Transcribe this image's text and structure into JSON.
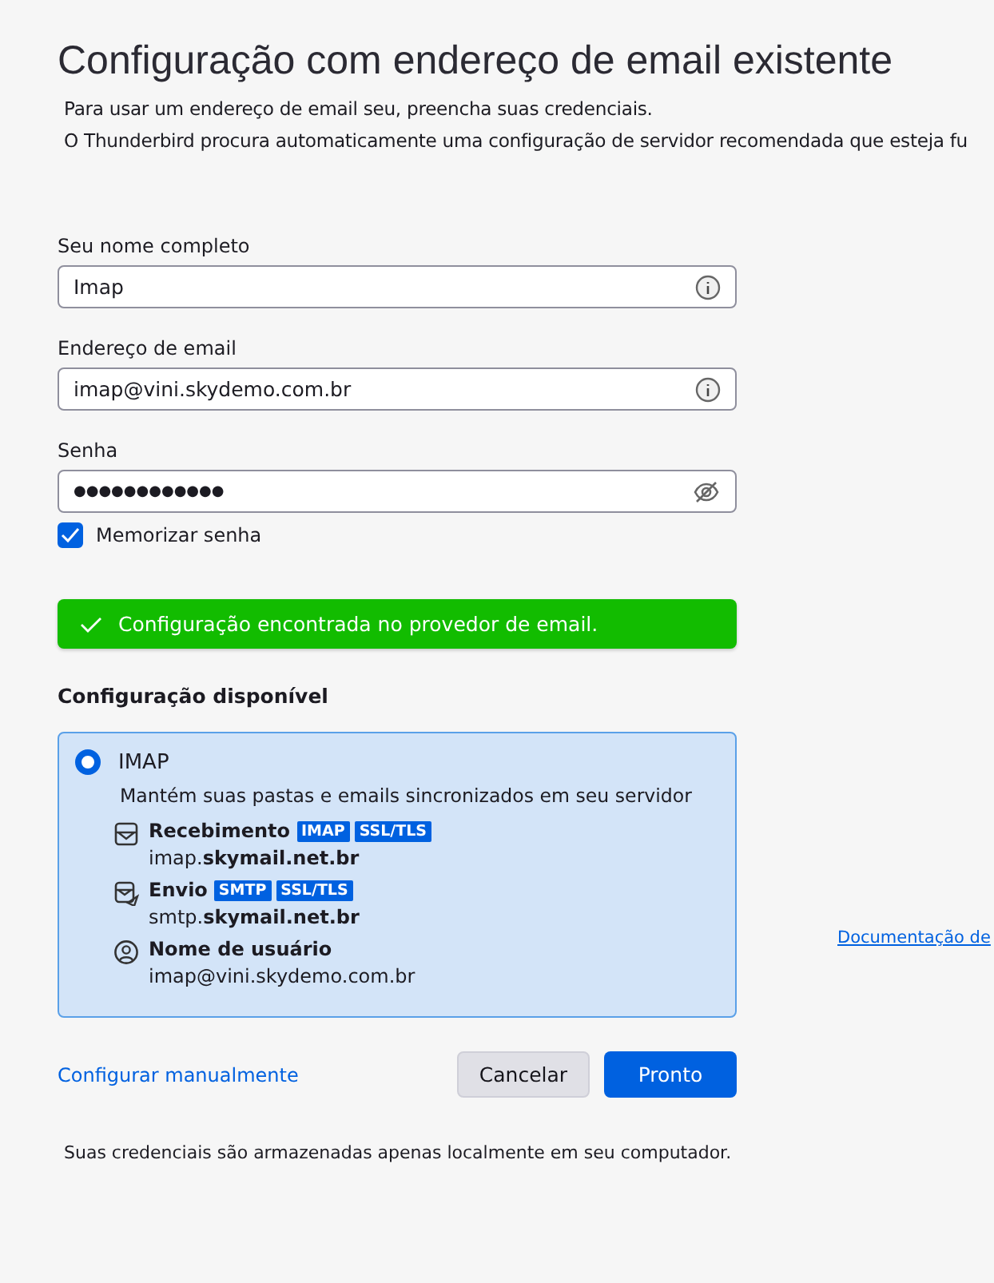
{
  "title": "Configuração com endereço de email existente",
  "intro": [
    "Para usar um endereço de email seu, preencha suas credenciais.",
    "O Thunderbird procura automaticamente uma configuração de servidor recomendada que esteja fu"
  ],
  "fields": [
    {
      "label": "Seu nome completo",
      "value": "Imap",
      "kind": "info"
    },
    {
      "label": "Endereço de email",
      "value": "imap@vini.skydemo.com.br",
      "kind": "info"
    },
    {
      "label": "Senha",
      "value": "●●●●●●●●●●●●",
      "kind": "password"
    }
  ],
  "remember": {
    "label": "Memorizar senha",
    "checked": true
  },
  "notice": {
    "text": "Configuração encontrada no provedor de email.",
    "kind": "success"
  },
  "config_heading": "Configuração disponível",
  "options": [
    {
      "name": "IMAP",
      "selected": true,
      "description": "Mantém suas pastas e emails sincronizados em seu servidor",
      "details": [
        {
          "kind": "incoming",
          "label": "Recebimento",
          "tags": [
            "IMAP",
            "SSL/TLS"
          ],
          "value": "imap.**skymail.net.br**"
        },
        {
          "kind": "outgoing",
          "label": "Envio",
          "tags": [
            "SMTP",
            "SSL/TLS"
          ],
          "value": "smtp.**skymail.net.br**"
        },
        {
          "kind": "user",
          "label": "Nome de usuário",
          "value": "imap@vini.skydemo.com.br"
        }
      ]
    }
  ],
  "manual_link": "Configurar manualmente",
  "buttons": [
    {
      "label": "Cancelar",
      "kind": "secondary"
    },
    {
      "label": "Pronto",
      "kind": "primary"
    }
  ],
  "footer": "Suas credenciais são armazenadas apenas localmente em seu computador.",
  "side_link": "Documentação de"
}
